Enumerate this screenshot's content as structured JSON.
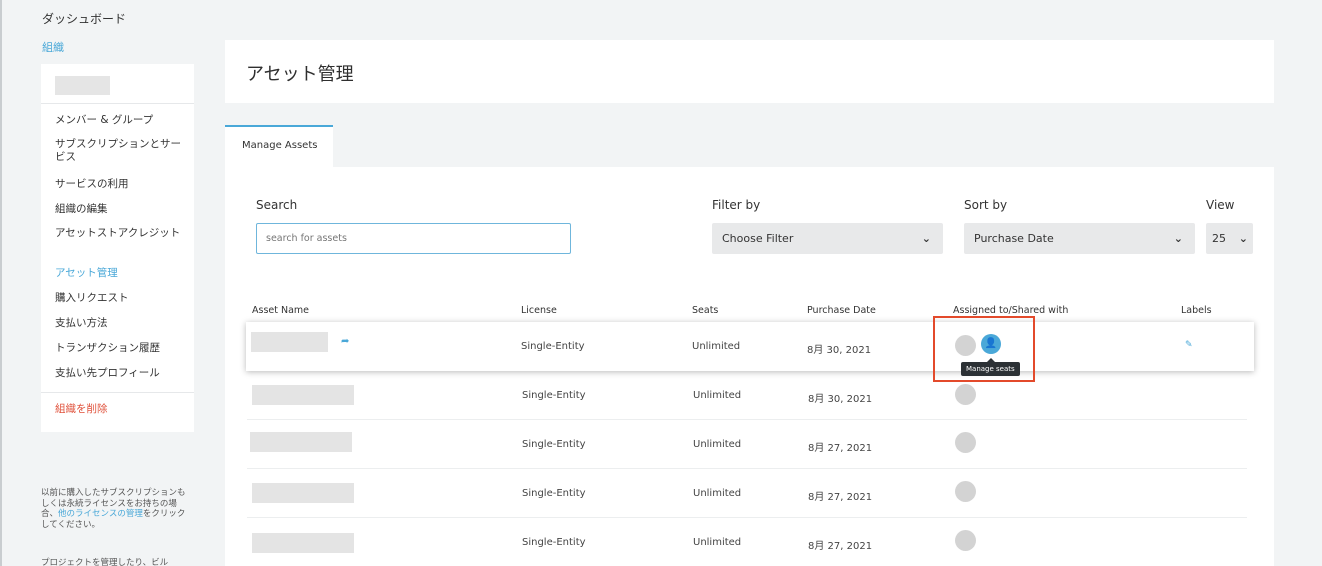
{
  "sidebar": {
    "dashboard": "ダッシュボード",
    "organization": "組織",
    "items": [
      {
        "label": "メンバー & グループ"
      },
      {
        "label": "サブスクリプションとサービス"
      },
      {
        "label": "サービスの利用"
      },
      {
        "label": "組織の編集"
      },
      {
        "label": "アセットストアクレジット"
      },
      {
        "label": "アセット管理"
      },
      {
        "label": "購入リクエスト"
      },
      {
        "label": "支払い方法"
      },
      {
        "label": "トランザクション履歴"
      },
      {
        "label": "支払い先プロフィール"
      }
    ],
    "delete_org": "組織を削除",
    "note_prefix": "以前に購入したサブスクリプションもしくは永続ライセンスをお持ちの場合、",
    "note_link": "他のライセンスの管理",
    "note_suffix": "をクリックしてください。",
    "note2": "プロジェクトを管理したり、ビル"
  },
  "page": {
    "title": "アセット管理",
    "tab": "Manage Assets"
  },
  "filters": {
    "search_label": "Search",
    "search_placeholder": "search for assets",
    "filter_label": "Filter by",
    "filter_value": "Choose Filter",
    "sort_label": "Sort by",
    "sort_value": "Purchase Date",
    "view_label": "View",
    "view_value": "25"
  },
  "table": {
    "headers": {
      "name": "Asset Name",
      "license": "License",
      "seats": "Seats",
      "date": "Purchase Date",
      "assigned": "Assigned to/Shared with",
      "labels": "Labels"
    },
    "rows": [
      {
        "license": "Single-Entity",
        "seats": "Unlimited",
        "date": "8月 30, 2021"
      },
      {
        "license": "Single-Entity",
        "seats": "Unlimited",
        "date": "8月 30, 2021"
      },
      {
        "license": "Single-Entity",
        "seats": "Unlimited",
        "date": "8月 27, 2021"
      },
      {
        "license": "Single-Entity",
        "seats": "Unlimited",
        "date": "8月 27, 2021"
      },
      {
        "license": "Single-Entity",
        "seats": "Unlimited",
        "date": "8月 27, 2021"
      }
    ],
    "tooltip": "Manage seats"
  },
  "colors": {
    "accent": "#4aa8d8",
    "danger": "#e0533d",
    "highlight_box": "#e34a2b"
  }
}
